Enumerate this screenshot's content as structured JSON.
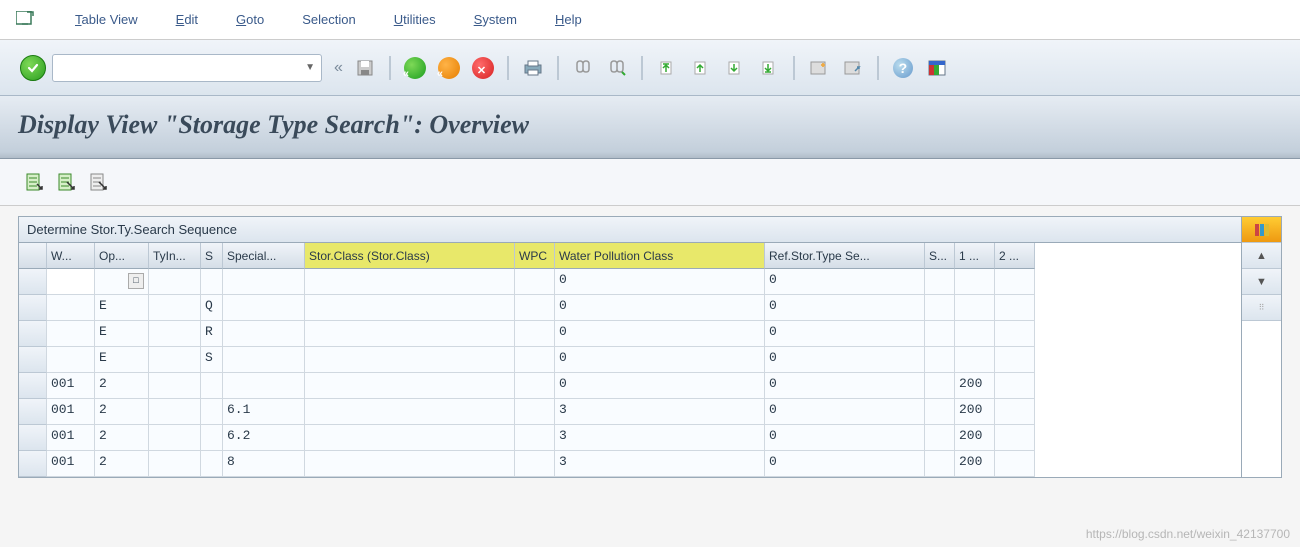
{
  "menu": {
    "table_view": "Table View",
    "edit": "Edit",
    "goto": "Goto",
    "selection": "Selection",
    "utilities": "Utilities",
    "system": "System",
    "help": "Help"
  },
  "page_title": "Display View \"Storage Type Search\": Overview",
  "table": {
    "title": "Determine Stor.Ty.Search Sequence",
    "columns": {
      "sel": "",
      "w": "W...",
      "op": "Op...",
      "tyin": "TyIn...",
      "s": "S",
      "special": "Special...",
      "storclass": "Stor.Class (Stor.Class)",
      "wpc": "WPC",
      "wpc_long": "Water Pollution Class",
      "ref": "Ref.Stor.Type Se...",
      "ss": "S...",
      "c1": "1 ...",
      "c2": "2 ..."
    },
    "rows": [
      {
        "w": "",
        "op": "",
        "tyin": "",
        "s": "",
        "special": "",
        "storclass": "",
        "wpc": "0",
        "ref": "0",
        "ss": "",
        "c1": "",
        "c2": "",
        "active": true,
        "f4": true
      },
      {
        "w": "",
        "op": "E",
        "tyin": "",
        "s": "Q",
        "special": "",
        "storclass": "",
        "wpc": "0",
        "ref": "0",
        "ss": "",
        "c1": "",
        "c2": ""
      },
      {
        "w": "",
        "op": "E",
        "tyin": "",
        "s": "R",
        "special": "",
        "storclass": "",
        "wpc": "0",
        "ref": "0",
        "ss": "",
        "c1": "",
        "c2": ""
      },
      {
        "w": "",
        "op": "E",
        "tyin": "",
        "s": "S",
        "special": "",
        "storclass": "",
        "wpc": "0",
        "ref": "0",
        "ss": "",
        "c1": "",
        "c2": ""
      },
      {
        "w": "001",
        "op": "2",
        "tyin": "",
        "s": "",
        "special": "",
        "storclass": "",
        "wpc": "0",
        "ref": "0",
        "ss": "",
        "c1": "200",
        "c2": ""
      },
      {
        "w": "001",
        "op": "2",
        "tyin": "",
        "s": "",
        "special": "6.1",
        "storclass": "",
        "wpc": "3",
        "ref": "0",
        "ss": "",
        "c1": "200",
        "c2": ""
      },
      {
        "w": "001",
        "op": "2",
        "tyin": "",
        "s": "",
        "special": "6.2",
        "storclass": "",
        "wpc": "3",
        "ref": "0",
        "ss": "",
        "c1": "200",
        "c2": ""
      },
      {
        "w": "001",
        "op": "2",
        "tyin": "",
        "s": "",
        "special": "8",
        "storclass": "",
        "wpc": "3",
        "ref": "0",
        "ss": "",
        "c1": "200",
        "c2": ""
      }
    ]
  },
  "watermark": "https://blog.csdn.net/weixin_42137700"
}
